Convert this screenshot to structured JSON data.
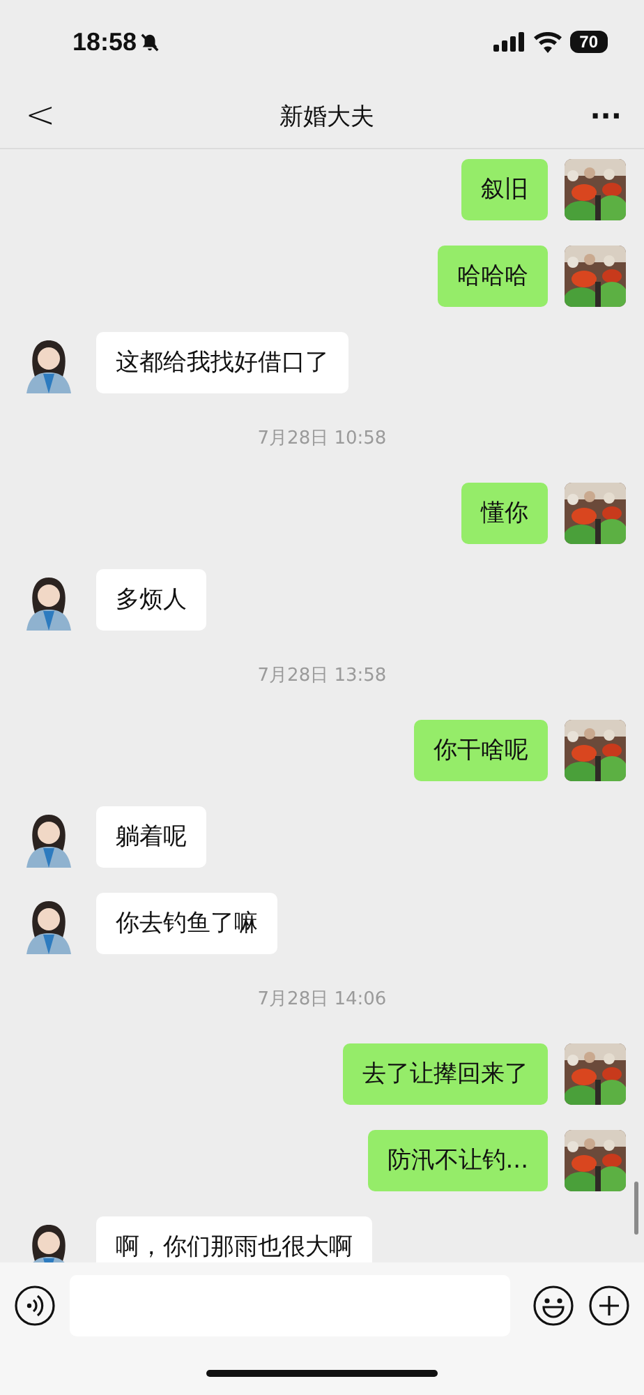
{
  "status_bar": {
    "time": "18:58",
    "battery": "70"
  },
  "header": {
    "back": "<",
    "title": "新婚大夫",
    "more": "···"
  },
  "messages": [
    {
      "kind": "sent",
      "text": "叙旧"
    },
    {
      "kind": "sent",
      "text": "哈哈哈"
    },
    {
      "kind": "received",
      "text": "这都给我找好借口了"
    },
    {
      "kind": "time",
      "text": "7月28日 10:58"
    },
    {
      "kind": "sent",
      "text": "懂你"
    },
    {
      "kind": "received",
      "text": "多烦人"
    },
    {
      "kind": "time",
      "text": "7月28日 13:58"
    },
    {
      "kind": "sent",
      "text": "你干啥呢"
    },
    {
      "kind": "received",
      "text": "躺着呢"
    },
    {
      "kind": "received",
      "text": "你去钓鱼了嘛"
    },
    {
      "kind": "time",
      "text": "7月28日 14:06"
    },
    {
      "kind": "sent",
      "text": "去了让撵回来了"
    },
    {
      "kind": "sent",
      "text": "防汛不让钓..."
    },
    {
      "kind": "received",
      "text": "啊，你们那雨也很大啊"
    }
  ]
}
